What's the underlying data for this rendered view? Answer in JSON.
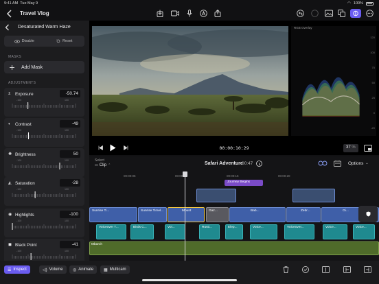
{
  "status": {
    "time": "9:41 AM",
    "date": "Tue May 9",
    "battery": "100%"
  },
  "topbar": {
    "project_title": "Travel Vlog"
  },
  "inspector": {
    "title": "Desaturated Warm Haze",
    "disable_label": "Disable",
    "reset_label": "Reset",
    "masks_label": "MASKS",
    "add_mask_label": "Add Mask",
    "adjustments_label": "ADJUSTMENTS",
    "adjustments": [
      {
        "label": "Exposure",
        "value": "-50.74",
        "icon": "exposure-icon",
        "ruler_min": "-100",
        "ruler_max": "100"
      },
      {
        "label": "Contrast",
        "value": "-49",
        "icon": "contrast-icon",
        "ruler_min": "-100",
        "ruler_max": "100"
      },
      {
        "label": "Brightness",
        "value": "50",
        "icon": "brightness-icon",
        "ruler_min": "-100",
        "ruler_max": "100"
      },
      {
        "label": "Saturation",
        "value": "-28",
        "icon": "saturation-icon",
        "ruler_min": "-100",
        "ruler_max": "100"
      },
      {
        "label": "Highlights",
        "value": "-100",
        "icon": "highlights-icon",
        "ruler_min": "-100",
        "ruler_max": "100"
      },
      {
        "label": "Black Point",
        "value": "-41",
        "icon": "black-point-icon",
        "ruler_min": "-100",
        "ruler_max": "100"
      }
    ]
  },
  "scope": {
    "title": "RGB Overlay",
    "ticks": [
      "120",
      "100",
      "75",
      "50",
      "25",
      "0",
      "-20"
    ]
  },
  "transport": {
    "timecode": "00:00:10:29",
    "zoom": "37",
    "zoom_unit": "%"
  },
  "timeline_header": {
    "select_label": "Select",
    "mode_label": "Clip",
    "project_name": "Safari Adventure",
    "duration": "00:47",
    "options_label": "Options"
  },
  "timeline": {
    "ruler": [
      "00:00:05",
      "00:00:10",
      "00:00:15",
      "00:00:20"
    ],
    "title_clip": "Journey Begins",
    "video_clips": [
      "Sunrise Ti...",
      "Sunrise Timel...",
      "Mount",
      "Gaz...",
      "Bab...",
      "Zebr...",
      "Gi..."
    ],
    "audio_clips": [
      "Voiceover T...",
      "Birds C...",
      "Voi...",
      "Rusti...",
      "Elep...",
      "Voice...",
      "Voiceover...",
      "Voice...",
      "Voice..."
    ],
    "music_label": "Mbarch"
  },
  "bottombar": {
    "inspect_label": "Inspect",
    "volume_label": "Volume",
    "animate_label": "Animate",
    "multicam_label": "Multicam"
  },
  "colors": {
    "accent": "#6a5cf0",
    "video_clip": "#3f5fa8",
    "audio_clip": "#1f8a8f",
    "selection": "#f2c744"
  }
}
